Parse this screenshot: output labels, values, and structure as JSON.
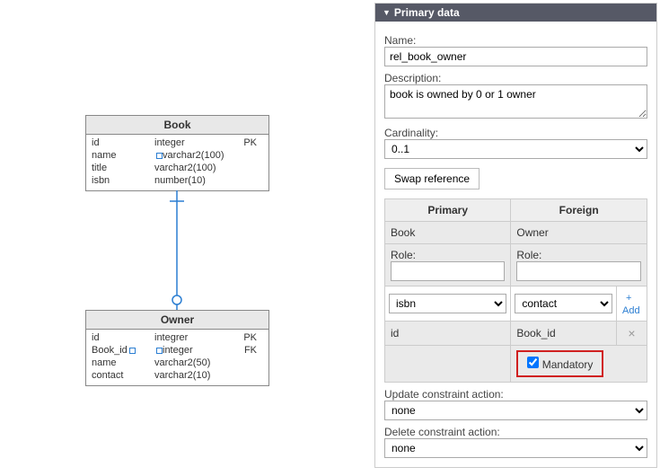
{
  "panel": {
    "title": "Primary data",
    "name_label": "Name:",
    "name_value": "rel_book_owner",
    "desc_label": "Description:",
    "desc_value": "book is owned by 0 or 1 owner",
    "card_label": "Cardinality:",
    "card_value": "0..1",
    "swap_label": "Swap reference",
    "primary_header": "Primary",
    "foreign_header": "Foreign",
    "primary_entity": "Book",
    "foreign_entity": "Owner",
    "role_label": "Role:",
    "primary_role": "",
    "foreign_role": "",
    "primary_col": "isbn",
    "foreign_col": "contact",
    "add_label": "+ Add",
    "map_primary": "id",
    "map_foreign": "Book_id",
    "mandatory_label": "Mandatory",
    "update_label": "Update constraint action:",
    "update_value": "none",
    "delete_label": "Delete constraint action:",
    "delete_value": "none"
  },
  "entities": {
    "book": {
      "title": "Book",
      "rows": [
        {
          "a": "id",
          "b": "integer",
          "c": "PK"
        },
        {
          "a": "name",
          "b": "varchar2(100)",
          "c": ""
        },
        {
          "a": "title",
          "b": "varchar2(100)",
          "c": ""
        },
        {
          "a": "isbn",
          "b": "number(10)",
          "c": ""
        }
      ]
    },
    "owner": {
      "title": "Owner",
      "rows": [
        {
          "a": "id",
          "b": "integrer",
          "c": "PK"
        },
        {
          "a": "Book_id",
          "b": "integer",
          "c": "FK"
        },
        {
          "a": "name",
          "b": "varchar2(50)",
          "c": ""
        },
        {
          "a": "contact",
          "b": "varchar2(10)",
          "c": ""
        }
      ]
    }
  }
}
